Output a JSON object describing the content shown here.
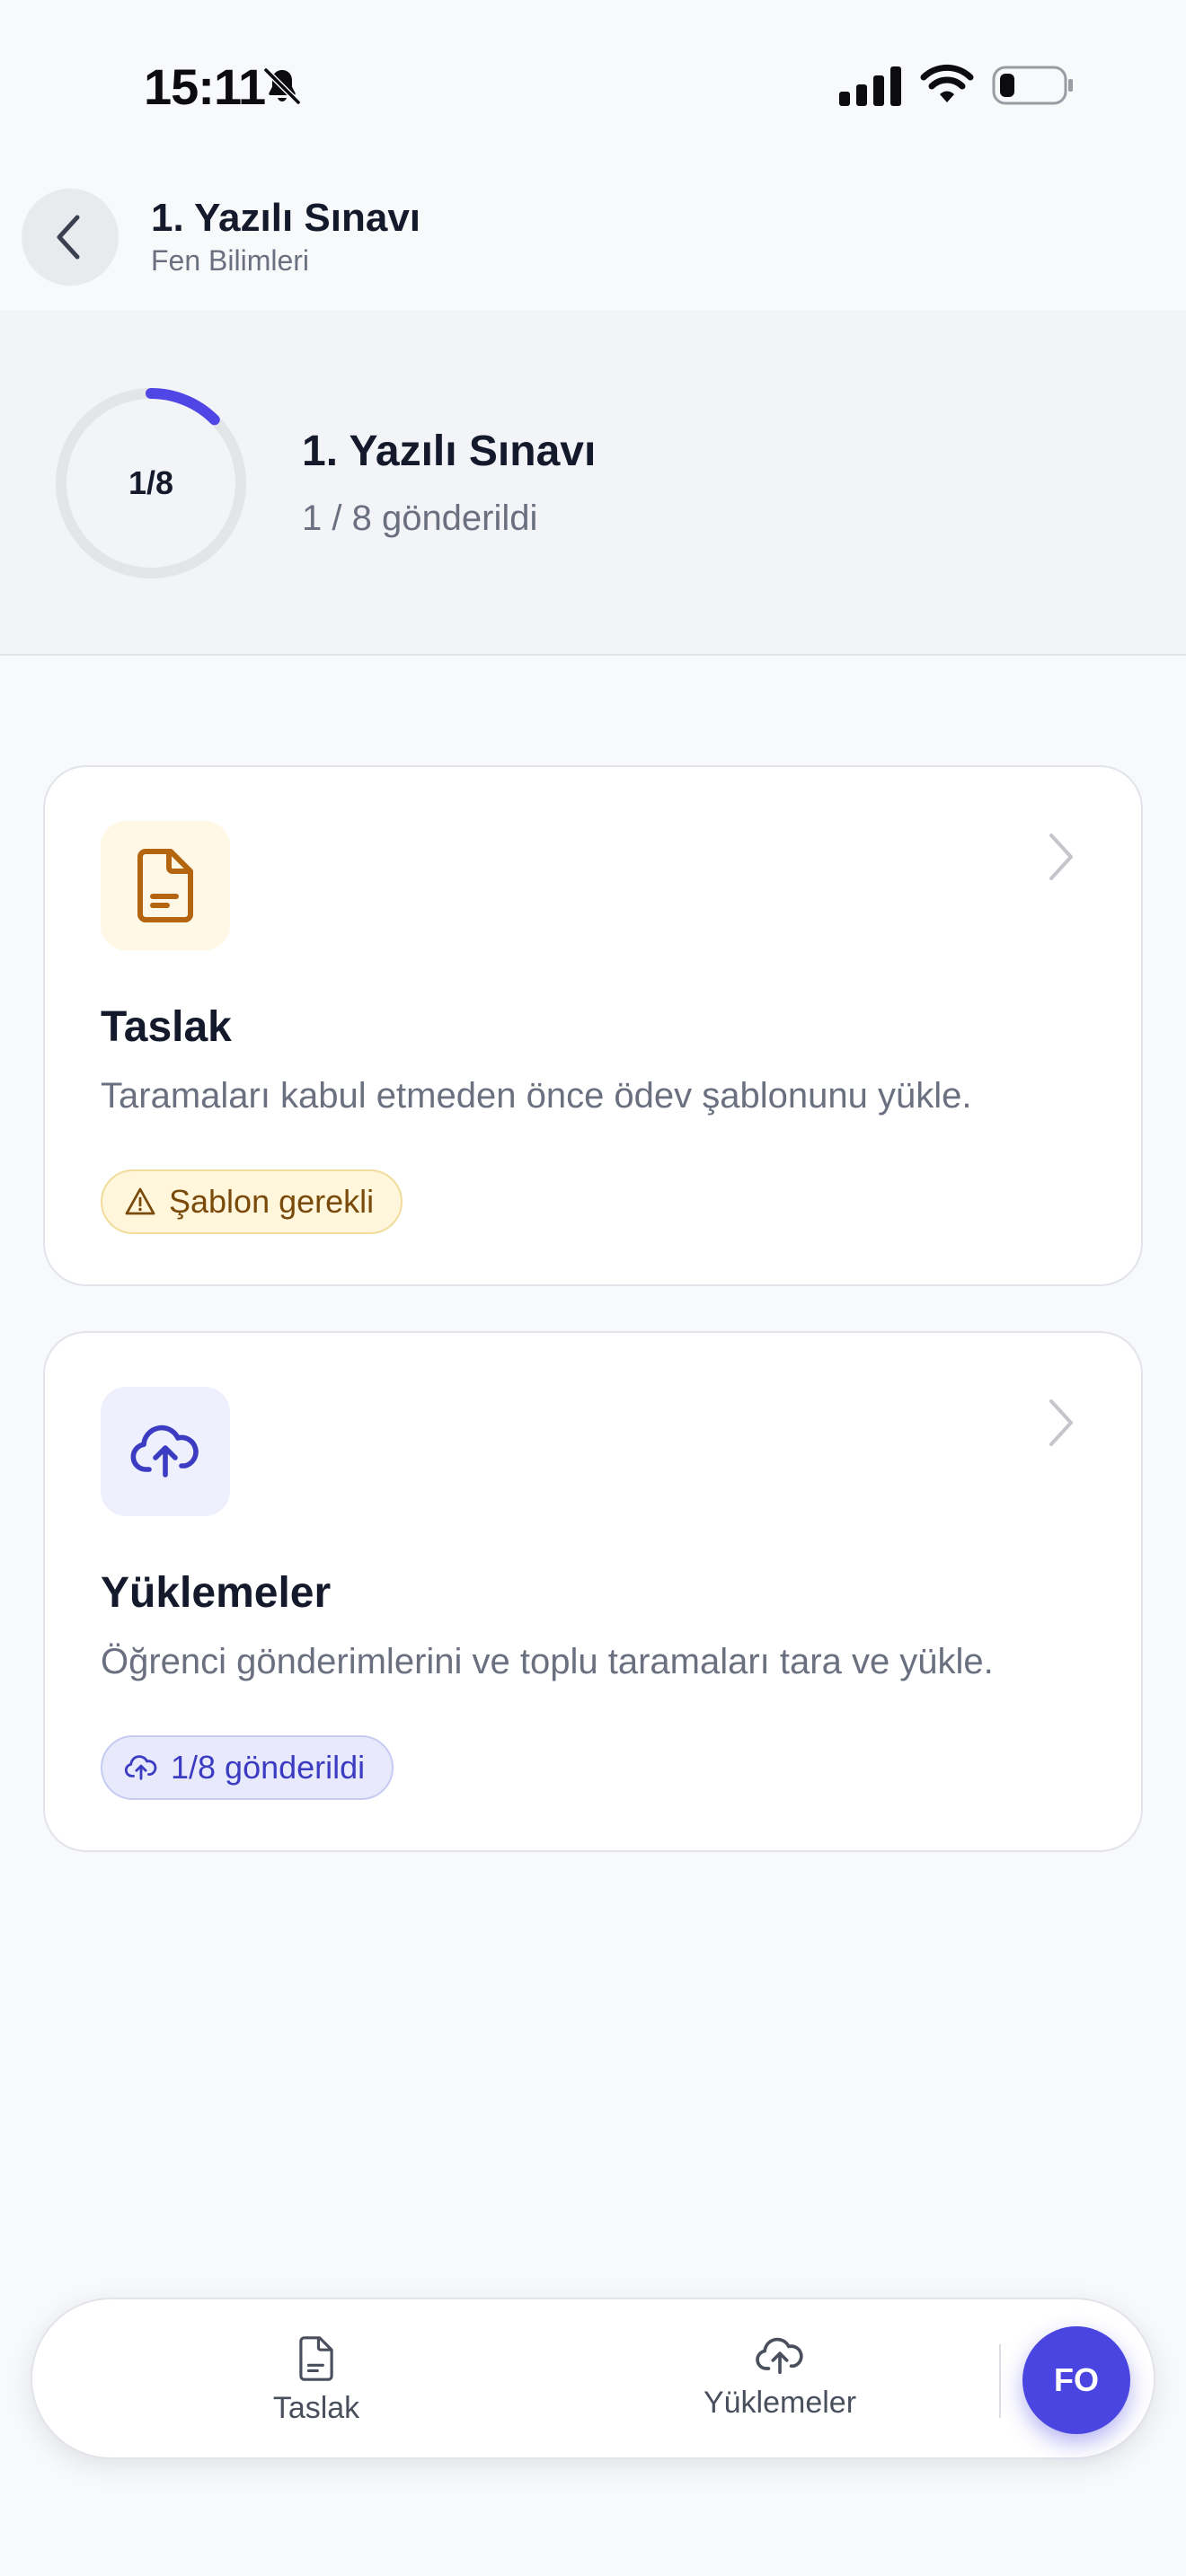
{
  "status_bar": {
    "time": "15:11"
  },
  "header": {
    "title": "1. Yazılı Sınavı",
    "subtitle": "Fen Bilimleri"
  },
  "progress": {
    "ring_label": "1/8",
    "submitted": 1,
    "total": 8,
    "title": "1. Yazılı Sınavı",
    "subtitle": "1 / 8 gönderildi",
    "ring_color": "#4f46e5"
  },
  "cards": {
    "draft": {
      "icon": "document-icon",
      "title": "Taslak",
      "description": "Taramaları kabul etmeden önce ödev şablonunu yükle.",
      "badge_icon": "warning-icon",
      "badge_label": "Şablon gerekli",
      "accent": "#b4650f"
    },
    "uploads": {
      "icon": "cloud-upload-icon",
      "title": "Yüklemeler",
      "description": "Öğrenci gönderimlerini ve toplu taramaları tara ve yükle.",
      "badge_icon": "cloud-upload-icon",
      "badge_label": "1/8 gönderildi",
      "accent": "#3b3cc2"
    }
  },
  "tab_bar": {
    "tabs": [
      {
        "label": "Taslak",
        "icon": "document-icon"
      },
      {
        "label": "Yüklemeler",
        "icon": "cloud-upload-icon"
      }
    ],
    "avatar_initials": "FO",
    "avatar_color": "#4a45e0"
  }
}
